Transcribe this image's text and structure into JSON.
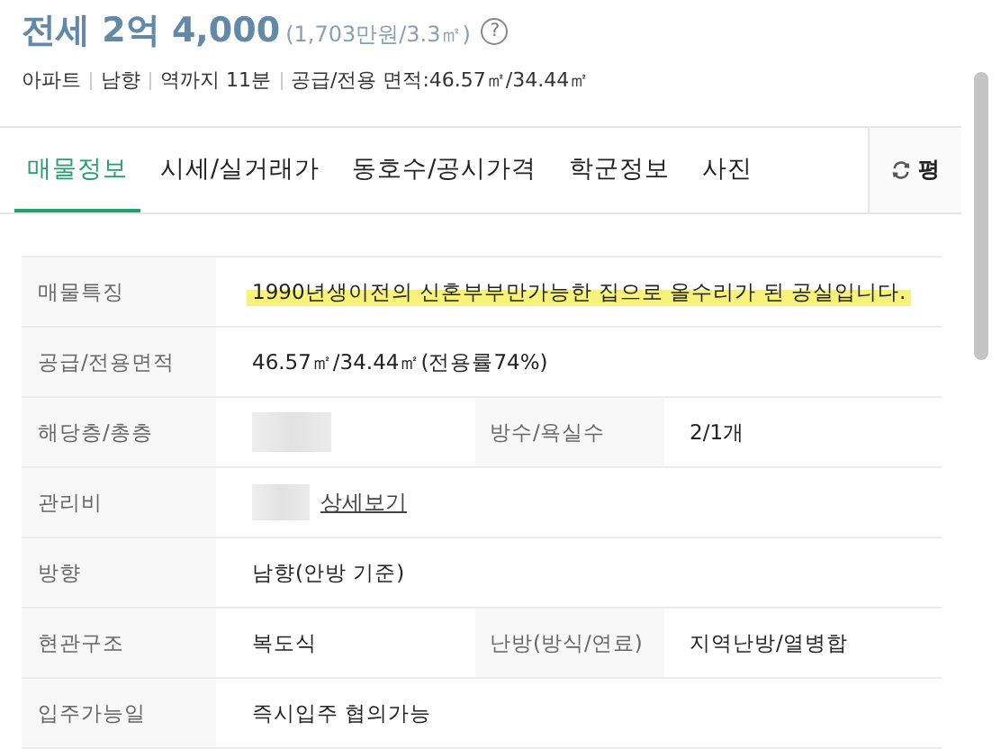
{
  "header": {
    "price": "전세 2억 4,000",
    "unit_price": "(1,703만원/3.3㎡)",
    "help": "?",
    "meta": [
      "아파트",
      "남향",
      "역까지 11분",
      "공급/전용 면적:46.57㎡/34.44㎡"
    ]
  },
  "tabs": [
    {
      "label": "매물정보",
      "selected": true
    },
    {
      "label": "시세/실거래가",
      "selected": false
    },
    {
      "label": "동호수/공시가격",
      "selected": false
    },
    {
      "label": "학군정보",
      "selected": false
    },
    {
      "label": "사진",
      "selected": false
    }
  ],
  "unit_toggle": {
    "label": "평"
  },
  "rows": [
    {
      "label": "매물특징",
      "value": "1990년생이전의 신혼부부만가능한 집으로 올수리가 된 공실입니다.",
      "highlighted": true
    },
    {
      "label": "공급/전용면적",
      "value": "46.57㎡/34.44㎡(전용률74%)"
    },
    {
      "label": "해당층/총층",
      "redacted": true,
      "label_2": "방수/욕실수",
      "value_2": "2/1개"
    },
    {
      "label": "관리비",
      "redacted": true,
      "link": "상세보기"
    },
    {
      "label": "방향",
      "value": "남향(안방 기준)"
    },
    {
      "label": "현관구조",
      "value": "복도식",
      "label_2": "난방(방식/연료)",
      "value_2": "지역난방/열병합"
    },
    {
      "label": "입주가능일",
      "value": "즉시입주 협의가능"
    }
  ]
}
